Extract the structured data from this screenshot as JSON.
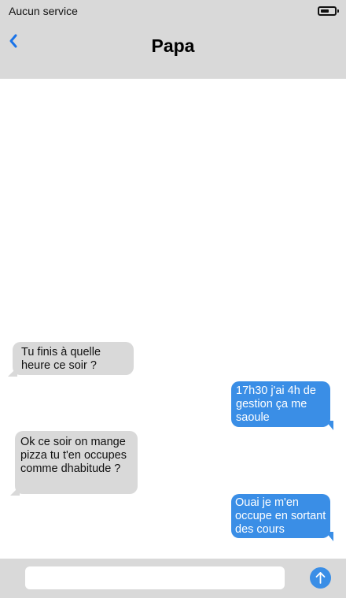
{
  "status_bar": {
    "carrier": "Aucun service",
    "battery_icon": "battery-icon",
    "battery_level": 0.6
  },
  "header": {
    "back_icon": "chevron-left-icon",
    "title": "Papa"
  },
  "messages": [
    {
      "direction": "received",
      "text": "Tu finis à quelle heure ce soir ?"
    },
    {
      "direction": "sent",
      "text": "17h30 j'ai 4h de gestion ça me saoule"
    },
    {
      "direction": "received",
      "text": "Ok ce soir on mange pizza tu t'en occupes comme dhabitude ?"
    },
    {
      "direction": "sent",
      "text": "Ouai je m'en occupe en sortant des cours"
    }
  ],
  "composer": {
    "input_value": "",
    "placeholder": "",
    "send_icon": "arrow-up-icon"
  },
  "colors": {
    "accent": "#3a8ee6",
    "bar_gray": "#d9d9d9",
    "received_bubble": "#d9d9d9",
    "sent_bubble": "#3a8ee6"
  }
}
